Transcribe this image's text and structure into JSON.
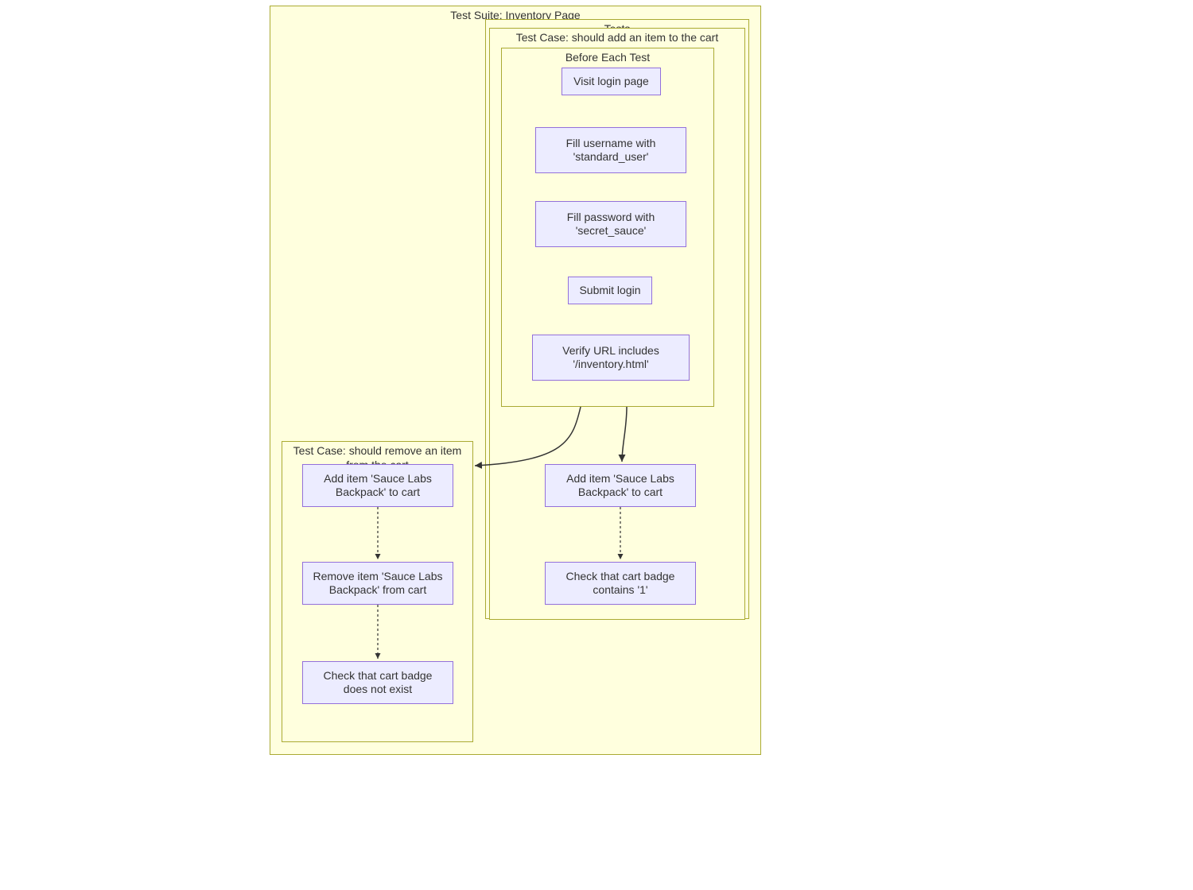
{
  "suite": {
    "title": "Test Suite: Inventory Page",
    "tests_label": "Tests",
    "before_each": {
      "title": "Before Each Test",
      "steps": [
        "Visit login page",
        "Fill username with 'standard_user'",
        "Fill password with 'secret_sauce'",
        "Submit login",
        "Verify URL includes '/inventory.html'"
      ]
    },
    "test_add": {
      "title": "Test Case: should add an item to the cart",
      "steps": [
        "Add item 'Sauce Labs Backpack' to cart",
        "Check that cart badge contains '1'"
      ]
    },
    "test_remove": {
      "title": "Test Case: should remove an item from the cart",
      "steps": [
        "Add item 'Sauce Labs Backpack' to cart",
        "Remove item 'Sauce Labs Backpack' from cart",
        "Check that cart badge does not exist"
      ]
    }
  }
}
